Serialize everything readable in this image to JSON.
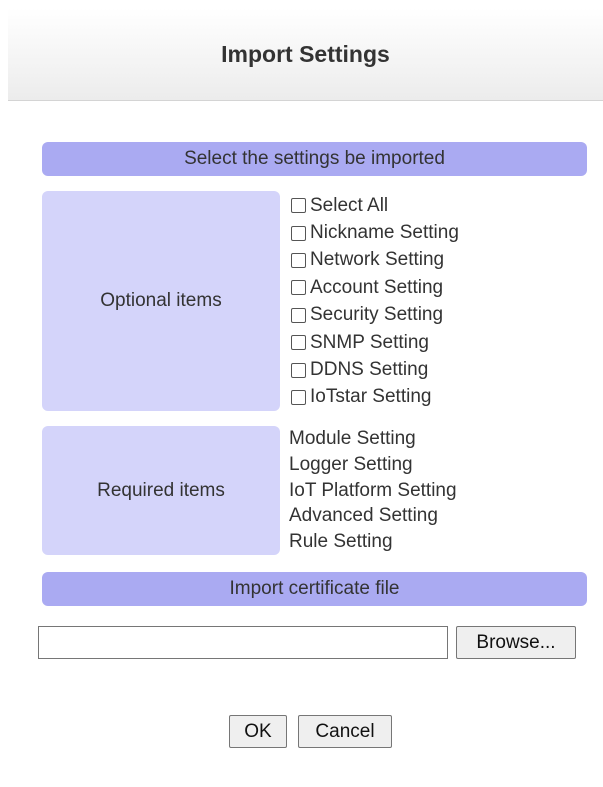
{
  "dialog": {
    "title": "Import Settings"
  },
  "select_section": {
    "header": "Select the settings be imported",
    "optional": {
      "label": "Optional items",
      "items": [
        {
          "label": "Select All",
          "checked": false
        },
        {
          "label": "Nickname Setting",
          "checked": false
        },
        {
          "label": "Network Setting",
          "checked": false
        },
        {
          "label": "Account Setting",
          "checked": false
        },
        {
          "label": "Security Setting",
          "checked": false
        },
        {
          "label": "SNMP Setting",
          "checked": false
        },
        {
          "label": "DDNS Setting",
          "checked": false
        },
        {
          "label": "IoTstar Setting",
          "checked": false
        }
      ]
    },
    "required": {
      "label": "Required items",
      "items": [
        "Module Setting",
        "Logger Setting",
        "IoT Platform Setting",
        "Advanced Setting",
        "Rule Setting"
      ]
    }
  },
  "certificate_section": {
    "header": "Import certificate file",
    "file_value": "",
    "browse_label": "Browse..."
  },
  "actions": {
    "ok_label": "OK",
    "cancel_label": "Cancel"
  },
  "colors": {
    "section_header_bg": "#aaaaf2",
    "category_bg": "#d4d4fa"
  }
}
